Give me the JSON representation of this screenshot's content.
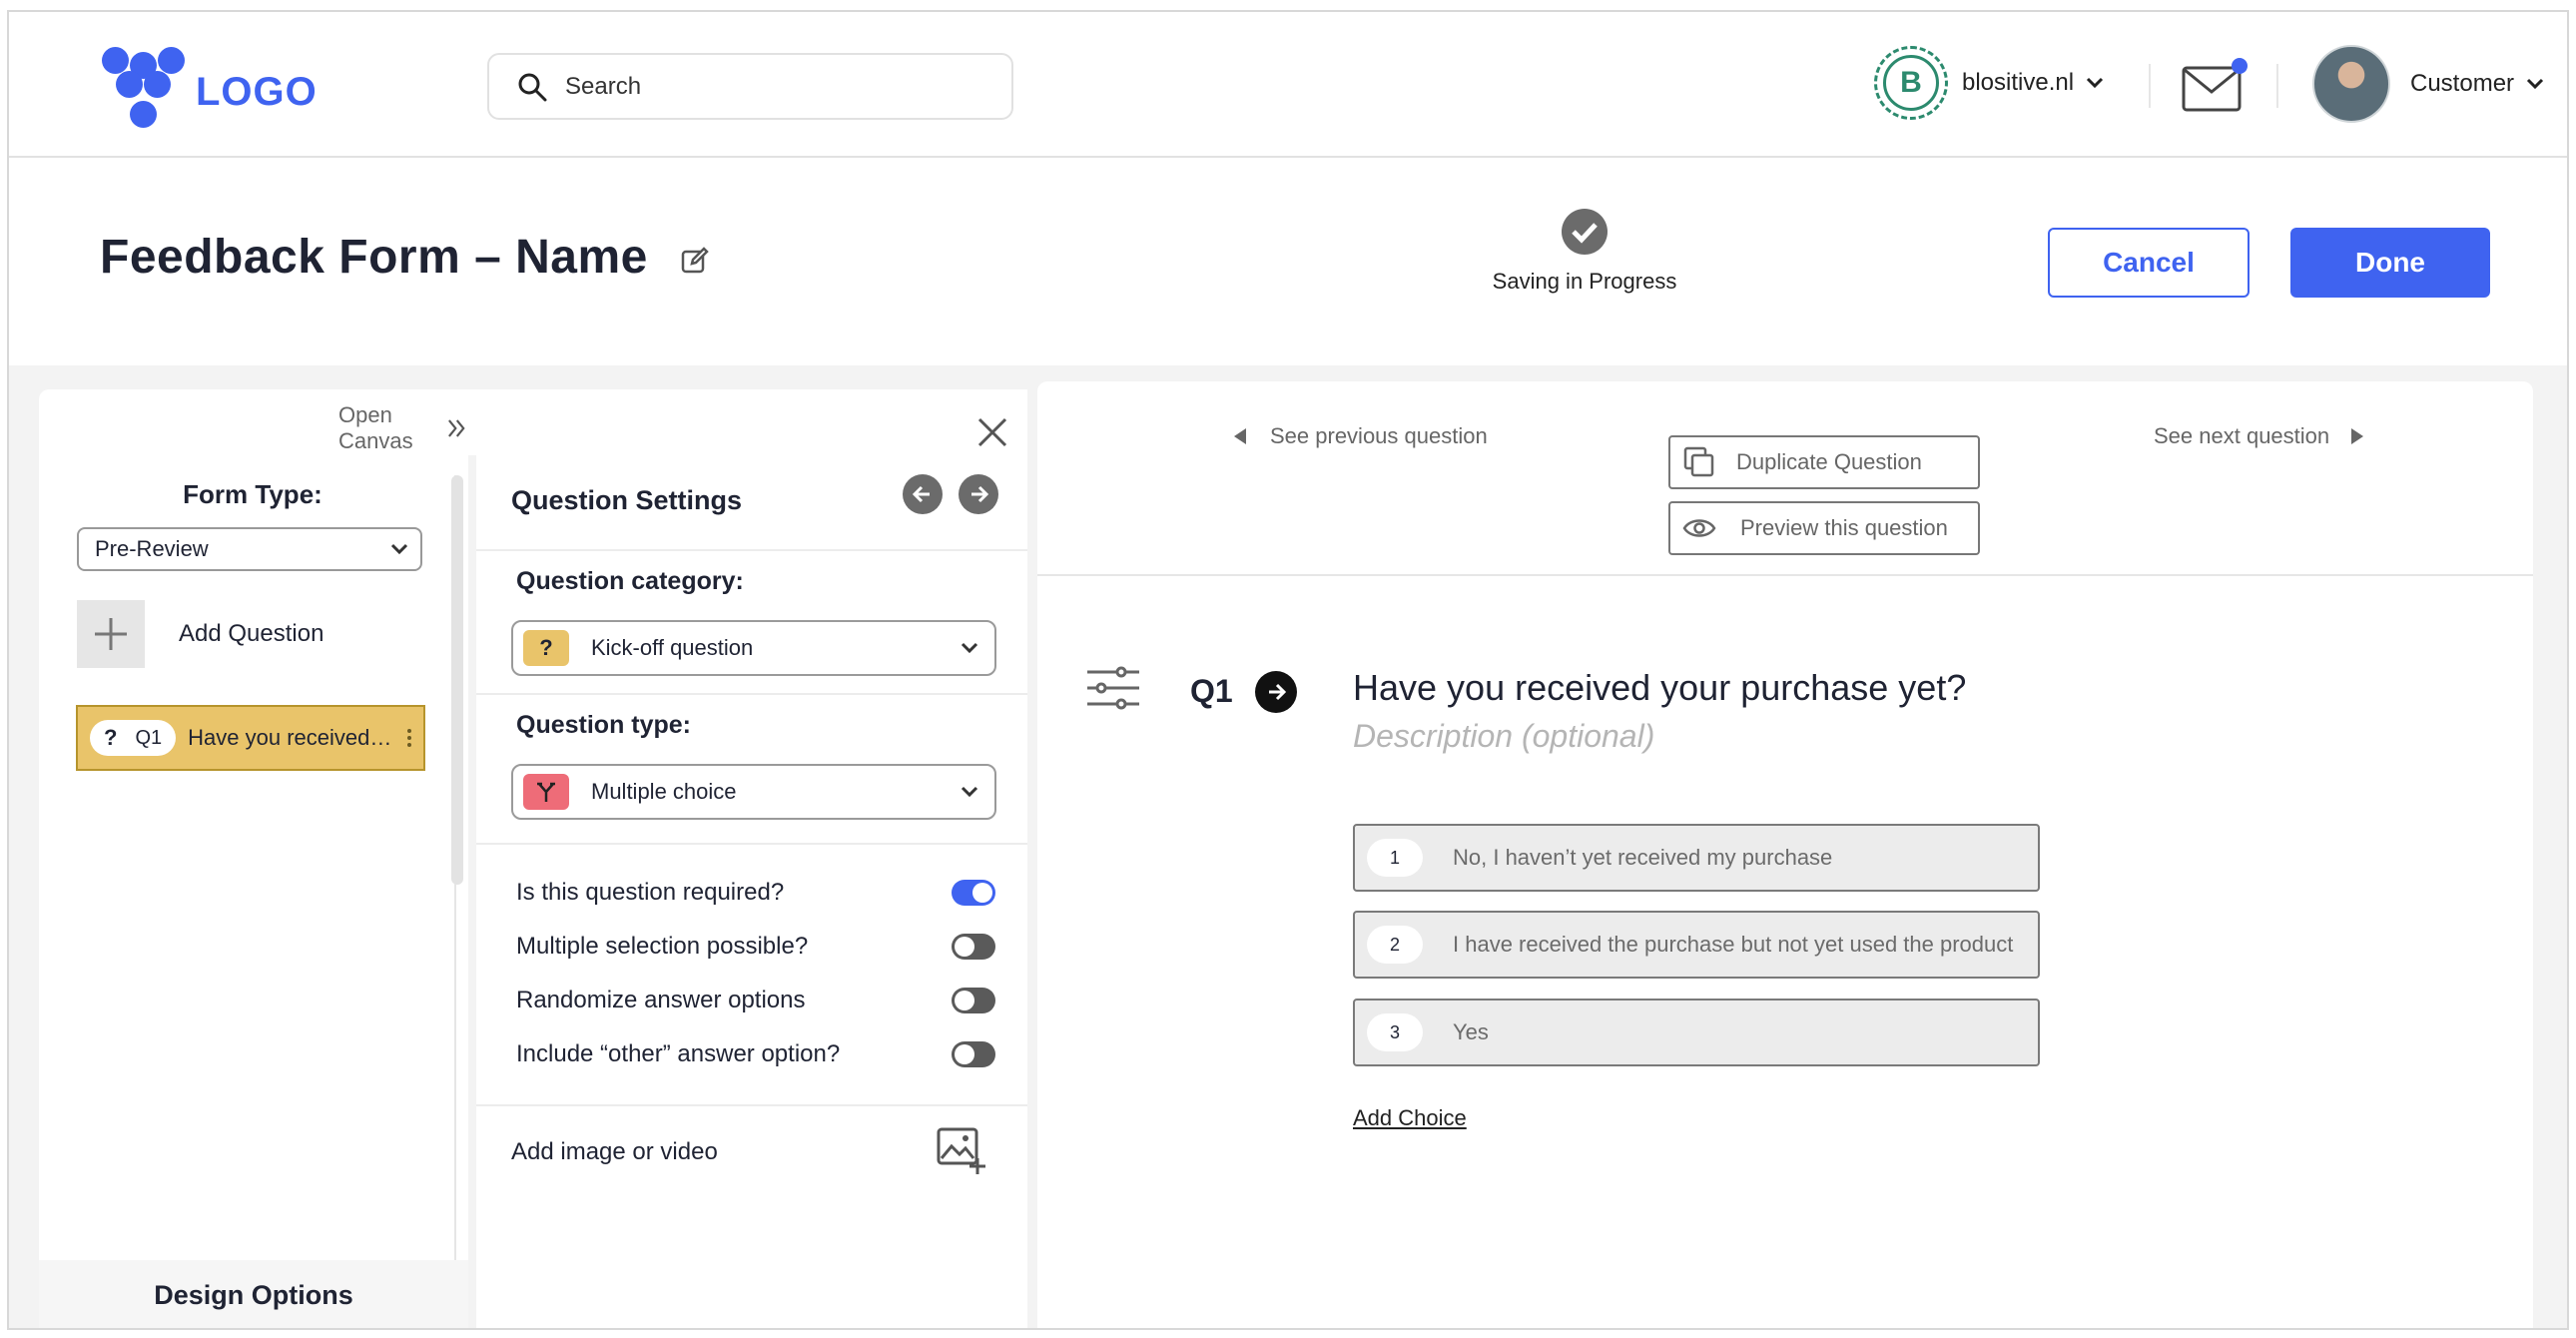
{
  "header": {
    "logo_text": "LOGO",
    "search_placeholder": "Search",
    "brand_initial": "B",
    "brand_name": "blositive.nl",
    "user_name": "Customer",
    "accent": "#3f63f0"
  },
  "titlebar": {
    "title": "Feedback Form – Name",
    "status": "Saving in Progress",
    "cancel_label": "Cancel",
    "done_label": "Done"
  },
  "left": {
    "open_canvas": "Open Canvas",
    "form_type_label": "Form Type:",
    "form_type_value": "Pre-Review",
    "add_question": "Add Question",
    "question_item": {
      "icon": "?",
      "num": "Q1",
      "text": "Have you received your purchase yet?"
    },
    "design_options": "Design Options"
  },
  "settings": {
    "title": "Question Settings",
    "category_label": "Question category:",
    "category_icon": "?",
    "category_value": "Kick-off question",
    "type_label": "Question type:",
    "type_value": "Multiple choice",
    "toggles": [
      {
        "label": "Is this question required?",
        "on": true
      },
      {
        "label": "Multiple selection possible?",
        "on": false
      },
      {
        "label": "Randomize answer options",
        "on": false
      },
      {
        "label": "Include “other” answer option?",
        "on": false
      }
    ],
    "add_media": "Add image or video"
  },
  "main": {
    "prev": "See previous question",
    "next": "See next question",
    "duplicate": "Duplicate Question",
    "preview": "Preview this question",
    "qnum": "Q1",
    "question": "Have you received your purchase yet?",
    "description": "Description (optional)",
    "choices": [
      {
        "num": "1",
        "text": "No, I haven’t yet received my purchase"
      },
      {
        "num": "2",
        "text": "I have received the purchase but not yet used the product"
      },
      {
        "num": "3",
        "text": "Yes"
      }
    ],
    "add_choice": "Add Choice"
  }
}
